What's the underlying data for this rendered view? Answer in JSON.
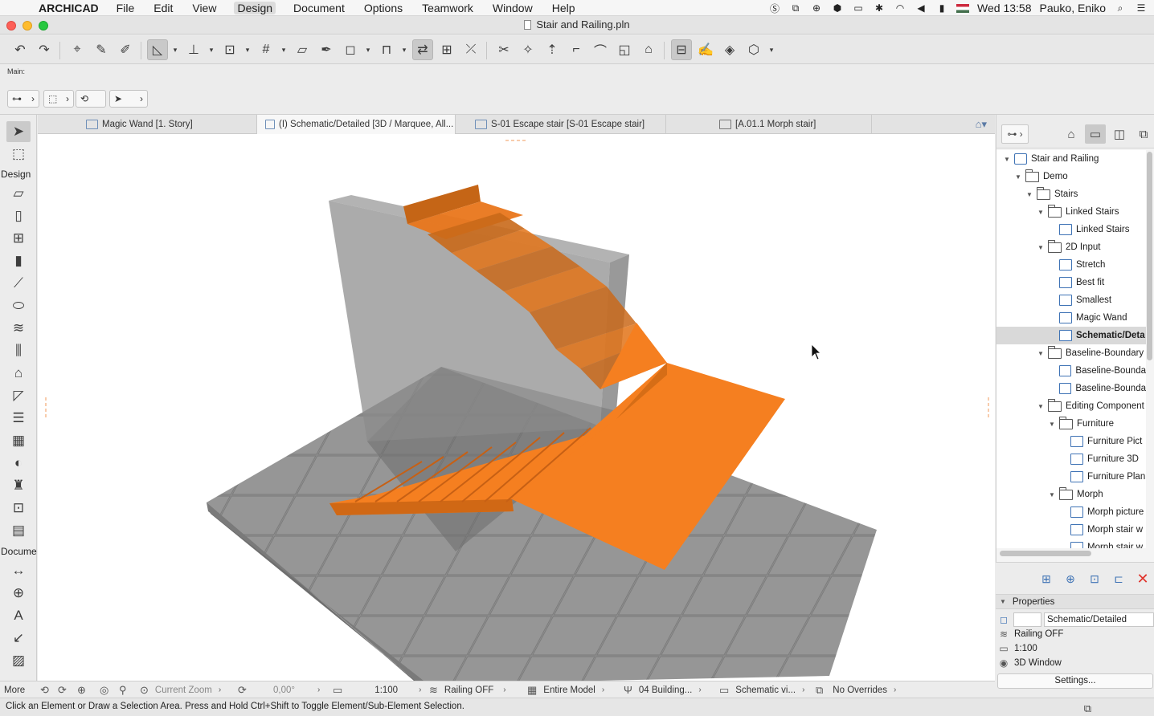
{
  "menubar": {
    "app_name": "ARCHICAD",
    "items": [
      "File",
      "Edit",
      "View",
      "Design",
      "Document",
      "Options",
      "Teamwork",
      "Window",
      "Help"
    ],
    "active_item": "Design",
    "clock": "Wed 13:58",
    "user": "Pauko, Eniko"
  },
  "window": {
    "title": "Stair and Railing.pln"
  },
  "infobox": {
    "label": "Main:"
  },
  "toolbox": {
    "sections": {
      "design": "Design",
      "document": "Docume",
      "more": "More"
    }
  },
  "tabs": [
    {
      "label": "Magic Wand [1. Story]",
      "active": false
    },
    {
      "label": "(I) Schematic/Detailed [3D / Marquee, All...",
      "active": true
    },
    {
      "label": "S-01 Escape stair [S-01 Escape stair]",
      "active": false
    },
    {
      "label": "[A.01.1 Morph stair]",
      "active": false
    }
  ],
  "bottombar": {
    "zoom_label": "Current Zoom",
    "angle": "0,00°",
    "scale": "1:100",
    "railing": "Railing OFF",
    "model": "Entire Model",
    "layer": "04 Building...",
    "view": "Schematic vi...",
    "overrides": "No Overrides"
  },
  "status": {
    "message": "Click an Element or Draw a Selection Area. Press and Hold Ctrl+Shift to Toggle Element/Sub-Element Selection."
  },
  "navigator": {
    "tree": [
      {
        "label": "Stair and Railing",
        "level": 0,
        "icon": "proj",
        "expanded": true
      },
      {
        "label": "Demo",
        "level": 1,
        "icon": "folder",
        "expanded": true
      },
      {
        "label": "Stairs",
        "level": 2,
        "icon": "folder",
        "expanded": true
      },
      {
        "label": "Linked Stairs",
        "level": 3,
        "icon": "folder",
        "expanded": true
      },
      {
        "label": "Linked Stairs",
        "level": 4,
        "icon": "view"
      },
      {
        "label": "2D Input",
        "level": 3,
        "icon": "folder",
        "expanded": true
      },
      {
        "label": "Stretch",
        "level": 4,
        "icon": "view"
      },
      {
        "label": "Best fit",
        "level": 4,
        "icon": "view"
      },
      {
        "label": "Smallest",
        "level": 4,
        "icon": "view"
      },
      {
        "label": "Magic Wand",
        "level": 4,
        "icon": "view"
      },
      {
        "label": "Schematic/Deta",
        "level": 4,
        "icon": "view",
        "selected": true
      },
      {
        "label": "Baseline-Boundary",
        "level": 3,
        "icon": "folder",
        "expanded": true
      },
      {
        "label": "Baseline-Bounda",
        "level": 4,
        "icon": "view"
      },
      {
        "label": "Baseline-Bounda",
        "level": 4,
        "icon": "view"
      },
      {
        "label": "Editing Component",
        "level": 3,
        "icon": "folder",
        "expanded": true
      },
      {
        "label": "Furniture",
        "level": 4,
        "icon": "folder",
        "expanded": true
      },
      {
        "label": "Furniture Pict",
        "level": 5,
        "icon": "view"
      },
      {
        "label": "Furniture 3D",
        "level": 5,
        "icon": "view"
      },
      {
        "label": "Furniture Plan",
        "level": 5,
        "icon": "view"
      },
      {
        "label": "Morph",
        "level": 4,
        "icon": "folder",
        "expanded": true
      },
      {
        "label": "Morph picture",
        "level": 5,
        "icon": "view"
      },
      {
        "label": "Morph stair w",
        "level": 5,
        "icon": "view"
      },
      {
        "label": "Morph stair w",
        "level": 5,
        "icon": "view"
      }
    ]
  },
  "properties": {
    "header": "Properties",
    "view_name": "Schematic/Detailed",
    "railing": "Railing OFF",
    "scale": "1:100",
    "window": "3D Window",
    "settings_button": "Settings..."
  },
  "colors": {
    "stair_orange": "#f57f20",
    "wall_gray": "#8a8a8a",
    "slab_gray": "#8f8f8f",
    "accent_blue": "#3f73b5",
    "delete_red": "#e0332b"
  }
}
